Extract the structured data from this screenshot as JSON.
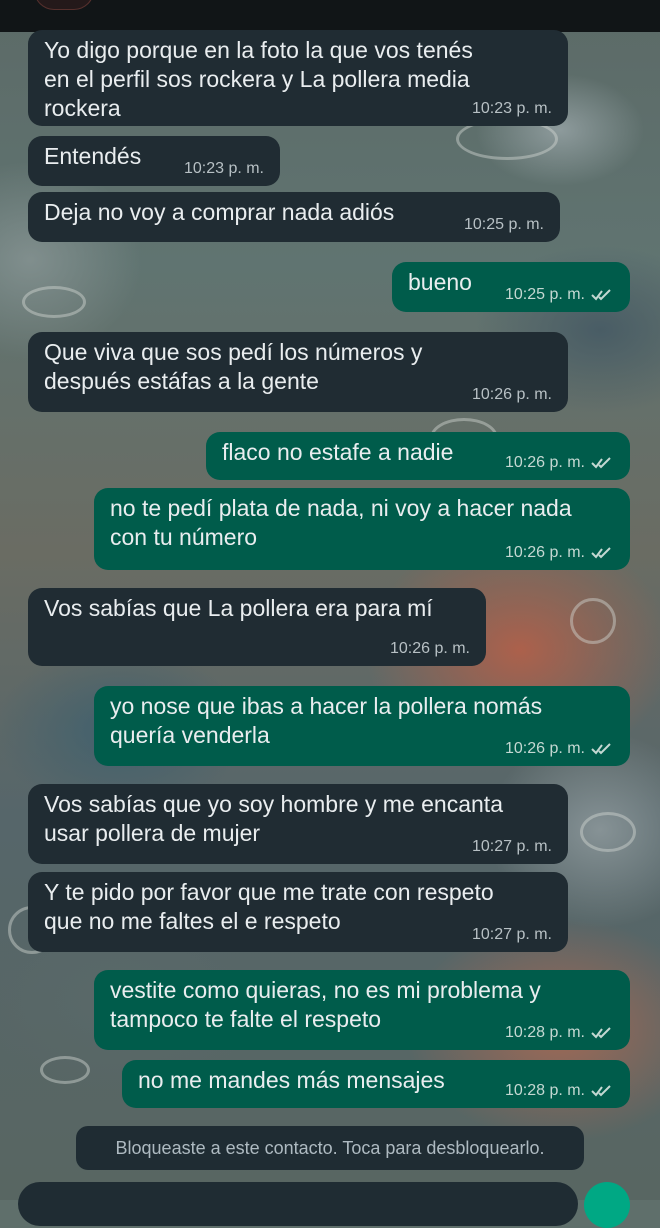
{
  "messages": [
    {
      "direction": "in",
      "text": "Yo digo porque en la foto la que vos tenés\nen el perfil sos rockera y La pollera media\nrockera",
      "time": "10:23 p. m."
    },
    {
      "direction": "in",
      "text": "Entendés",
      "time": "10:23 p. m."
    },
    {
      "direction": "in",
      "text": "Deja no voy a comprar nada adiós",
      "time": "10:25 p. m."
    },
    {
      "direction": "out",
      "text": "bueno",
      "time": "10:25 p. m."
    },
    {
      "direction": "in",
      "text": "Que viva que sos pedí los números y\ndespués estáfas a la gente",
      "time": "10:26 p. m."
    },
    {
      "direction": "out",
      "text": "flaco no estafe a nadie",
      "time": "10:26 p. m."
    },
    {
      "direction": "out",
      "text": "no te pedí plata de nada, ni voy a hacer nada\ncon tu número",
      "time": "10:26 p. m."
    },
    {
      "direction": "in",
      "text": "Vos sabías que La pollera era para mí",
      "time": "10:26 p. m."
    },
    {
      "direction": "out",
      "text": "yo nose que ibas a hacer la pollera nomás\nquería venderla",
      "time": "10:26 p. m."
    },
    {
      "direction": "in",
      "text": "Vos sabías que yo soy hombre y me encanta\nusar pollera de mujer",
      "time": "10:27 p. m."
    },
    {
      "direction": "in",
      "text": "Y te pido por favor que me trate con respeto\nque no me faltes el e respeto",
      "time": "10:27 p. m."
    },
    {
      "direction": "out",
      "text": "vestite como quieras, no es mi problema y\ntampoco te falte el respeto",
      "time": "10:28 p. m."
    },
    {
      "direction": "out",
      "text": "no me mandes más mensajes",
      "time": "10:28 p. m."
    }
  ],
  "blocked_notice": "Bloqueaste a este contacto. Toca para desbloquearlo.",
  "icons": {
    "read_receipt": "double-check-icon",
    "logo": "profile-logo-icon",
    "mic": "mic-icon"
  },
  "colors": {
    "incoming_bubble": "#202c33",
    "outgoing_bubble": "#005c4b",
    "text": "#e9edef",
    "timestamp": "#b7c0c4",
    "accent": "#00a884"
  }
}
